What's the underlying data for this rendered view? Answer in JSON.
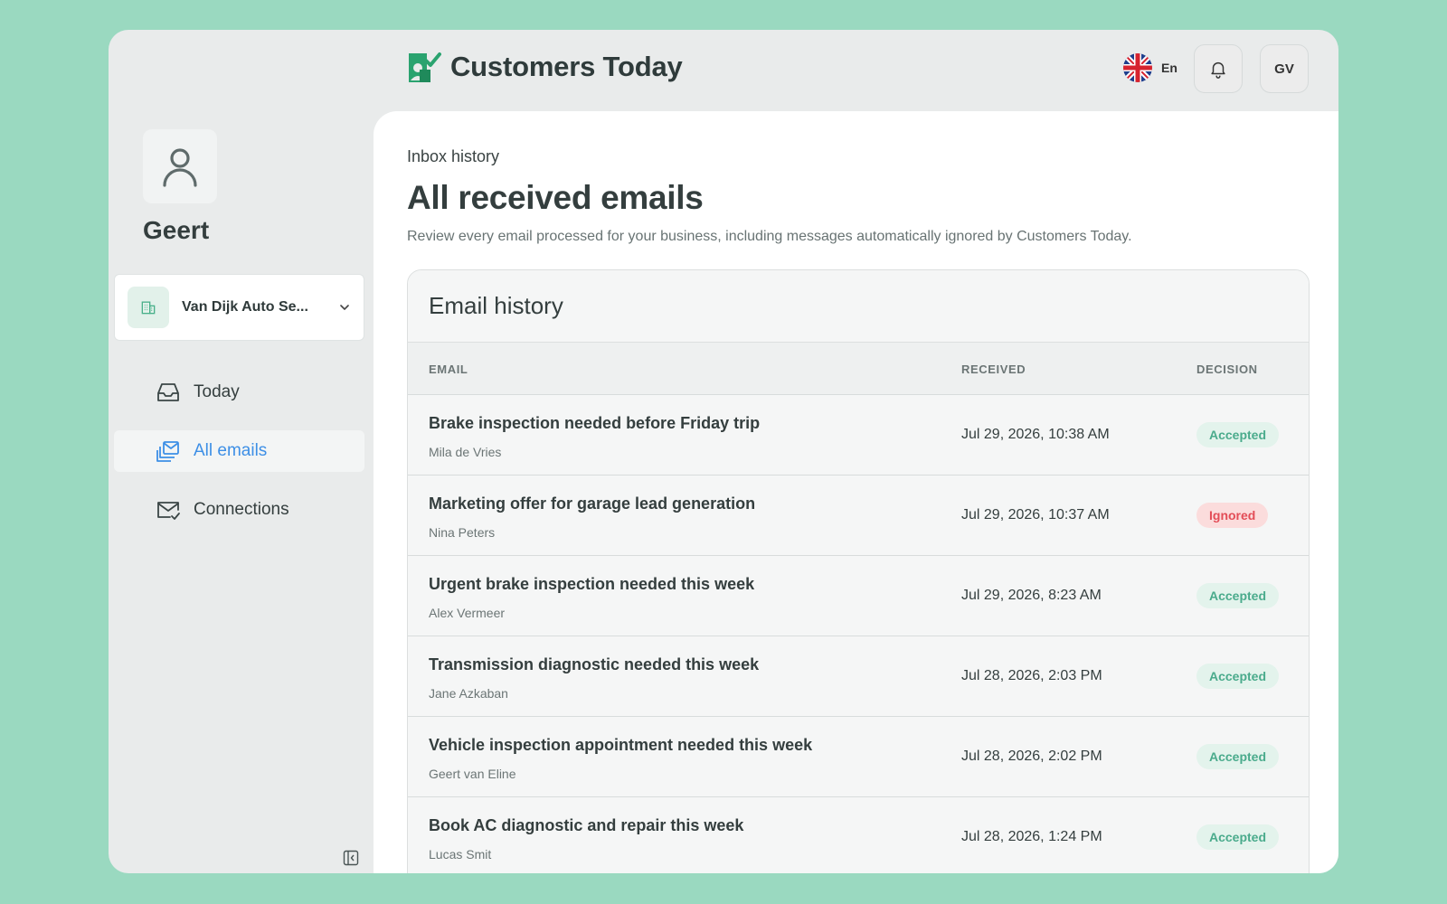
{
  "colors": {
    "background": "#9ad9c0",
    "brand_green": "#2aa36f",
    "active_nav": "#3d8fe6",
    "accepted": "#4aab8c",
    "ignored": "#e34d57"
  },
  "header": {
    "brand_name": "Customers Today",
    "brand_icon": "customers-today-logo",
    "language": {
      "label": "En",
      "flag": "uk-flag-icon"
    },
    "notifications_icon": "bell-icon",
    "avatar_initials": "GV"
  },
  "sidebar": {
    "profile_icon": "user-icon",
    "profile_name": "Geert",
    "business": {
      "name": "Van Dijk Auto Se...",
      "icon": "building-icon"
    },
    "nav": [
      {
        "label": "Today",
        "icon": "inbox-icon",
        "active": false
      },
      {
        "label": "All emails",
        "icon": "mail-stack-icon",
        "active": true
      },
      {
        "label": "Connections",
        "icon": "mail-check-icon",
        "active": false
      }
    ],
    "collapse_icon": "sidebar-collapse-icon"
  },
  "main": {
    "breadcrumb": "Inbox history",
    "title": "All received emails",
    "description": "Review every email processed for your business, including messages automatically ignored by Customers Today.",
    "card_title": "Email history",
    "columns": [
      "EMAIL",
      "RECEIVED",
      "DECISION"
    ],
    "rows": [
      {
        "subject": "Brake inspection needed before Friday trip",
        "sender": "Mila de Vries",
        "received": "Jul 29, 2026, 10:38 AM",
        "decision": "Accepted"
      },
      {
        "subject": "Marketing offer for garage lead generation",
        "sender": "Nina Peters",
        "received": "Jul 29, 2026, 10:37 AM",
        "decision": "Ignored"
      },
      {
        "subject": "Urgent brake inspection needed this week",
        "sender": "Alex Vermeer",
        "received": "Jul 29, 2026, 8:23 AM",
        "decision": "Accepted"
      },
      {
        "subject": "Transmission diagnostic needed this week",
        "sender": "Jane Azkaban",
        "received": "Jul 28, 2026, 2:03 PM",
        "decision": "Accepted"
      },
      {
        "subject": "Vehicle inspection appointment needed this week",
        "sender": "Geert van Eline",
        "received": "Jul 28, 2026, 2:02 PM",
        "decision": "Accepted"
      },
      {
        "subject": "Book AC diagnostic and repair this week",
        "sender": "Lucas Smit",
        "received": "Jul 28, 2026, 1:24 PM",
        "decision": "Accepted"
      }
    ]
  }
}
